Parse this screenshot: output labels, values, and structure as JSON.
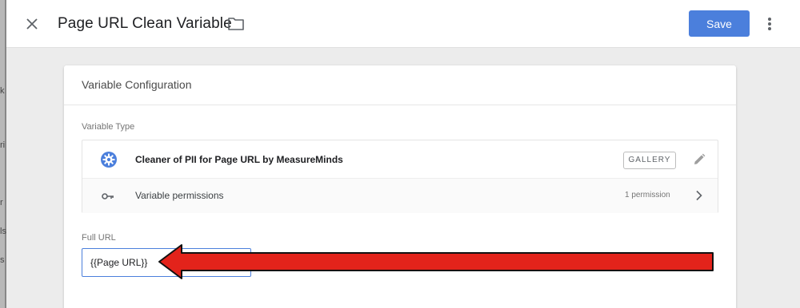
{
  "header": {
    "title": "Page URL Clean Variable",
    "save_label": "Save",
    "close_icon": "close-icon",
    "folder_icon": "folder-icon",
    "more_icon": "more-vert-icon"
  },
  "backdrop": {
    "fragments": [
      "k",
      "ri",
      "r",
      "ls",
      "s"
    ]
  },
  "card": {
    "header": "Variable Configuration",
    "variable_type_label": "Variable Type",
    "template": {
      "name": "Cleaner of PII for Page URL by MeasureMinds",
      "badge": "GALLERY",
      "icon": "gear-icon"
    },
    "permissions": {
      "label": "Variable permissions",
      "count": "1 permission",
      "icon": "key-icon"
    },
    "field": {
      "label": "Full URL",
      "value": "{{Page URL}}"
    }
  },
  "colors": {
    "accent": "#4b7fdc",
    "arrow_fill": "#e3231b",
    "arrow_stroke": "#111111"
  }
}
